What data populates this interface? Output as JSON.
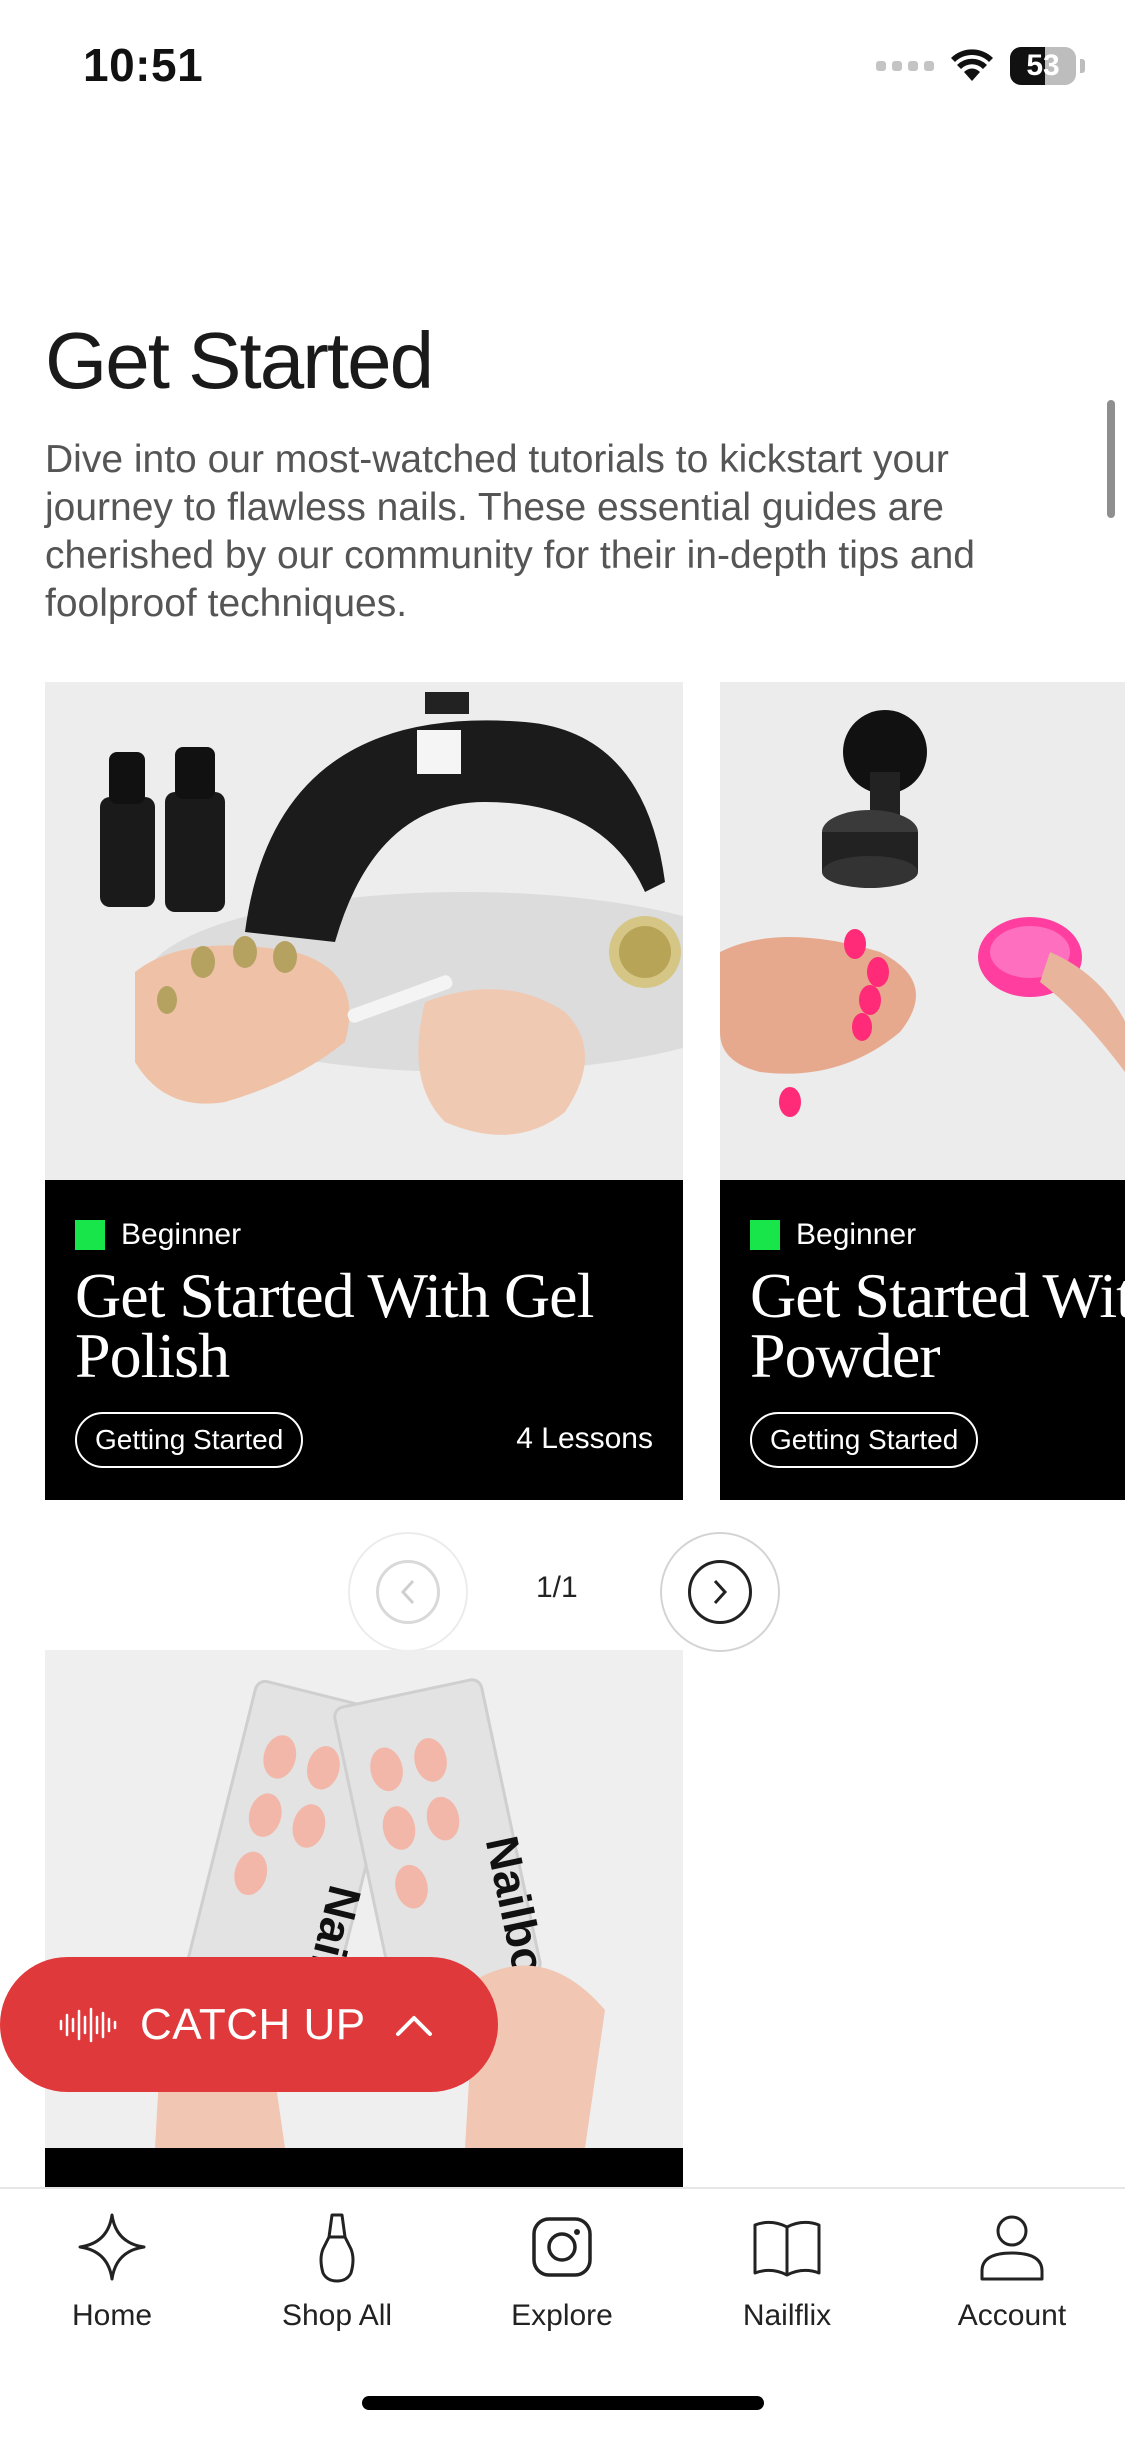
{
  "status_bar": {
    "time": "10:51",
    "battery": "53"
  },
  "section": {
    "title": "Get Started",
    "description": "Dive into our most-watched tutorials to kickstart your journey to flawless nails. These essential guides are cherished by our community for their in-depth tips and foolproof techniques."
  },
  "cards": [
    {
      "level": "Beginner",
      "title": "Get Started With Gel Polish",
      "tag": "Getting Started",
      "lessons": "4 Lessons"
    },
    {
      "level": "Beginner",
      "title": "Get Started With Powder",
      "tag": "Getting Started"
    }
  ],
  "pager": {
    "count": "1/1"
  },
  "catch_up": {
    "label": "CATCH UP"
  },
  "tab_bar": {
    "items": [
      {
        "label": "Home",
        "icon": "sparkle-icon"
      },
      {
        "label": "Shop All",
        "icon": "polish-bottle-icon"
      },
      {
        "label": "Explore",
        "icon": "instagram-icon"
      },
      {
        "label": "Nailflix",
        "icon": "book-icon"
      },
      {
        "label": "Account",
        "icon": "person-icon"
      }
    ]
  },
  "colors": {
    "accent_red": "#e0393b",
    "beginner_green": "#18e54a",
    "card_bg": "#000000"
  }
}
